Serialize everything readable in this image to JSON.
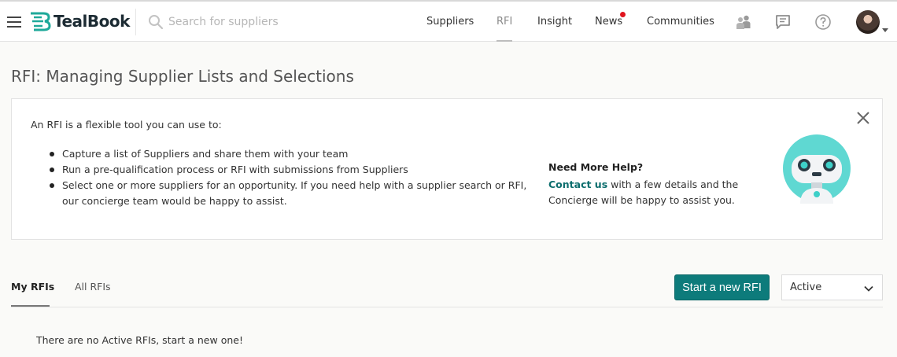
{
  "header": {
    "logo_text": "TealBook",
    "search_placeholder": "Search for suppliers",
    "nav": [
      {
        "label": "Suppliers"
      },
      {
        "label": "RFI"
      },
      {
        "label": "Insight"
      },
      {
        "label": "News"
      },
      {
        "label": "Communities"
      }
    ],
    "active_nav": "RFI",
    "icons": [
      "users-icon",
      "chat-icon",
      "help-icon"
    ]
  },
  "page": {
    "title": "RFI: Managing Supplier Lists and Selections"
  },
  "info_card": {
    "intro": "An RFI is a flexible tool you can use to:",
    "bullets": [
      "Capture a list of Suppliers and share them with your team",
      "Run a pre-qualification process or RFI with submissions from Suppliers",
      "Select one or more suppliers for an opportunity. If you need help with a supplier search or RFI, our concierge team would be happy to assist."
    ],
    "help_title": "Need More Help?",
    "help_link": "Contact us",
    "help_text": " with a few details and the Concierge will be happy to assist you."
  },
  "tabs": [
    {
      "label": "My RFIs"
    },
    {
      "label": "All RFIs"
    }
  ],
  "actions": {
    "start_button": "Start a new RFI",
    "filter_value": "Active"
  },
  "empty_message": "There are no Active RFIs, start a new one!",
  "colors": {
    "brand_teal": "#0d7b7b",
    "link_teal": "#0d6e6e",
    "notification_red": "#e0141e"
  }
}
